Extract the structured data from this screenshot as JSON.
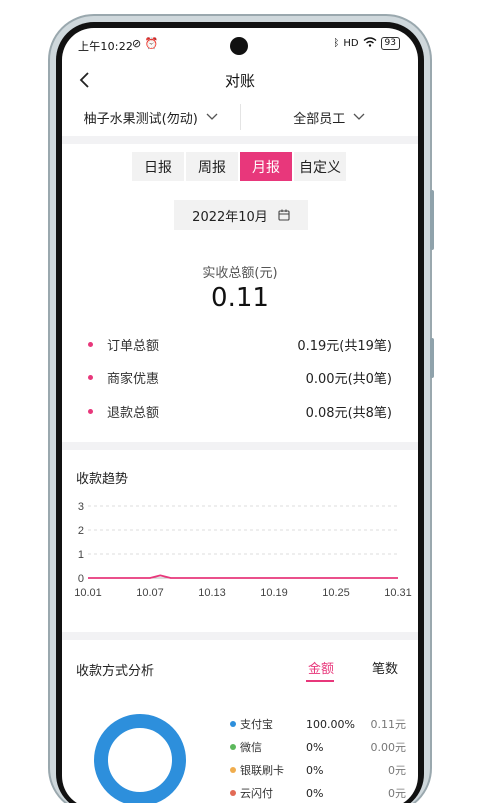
{
  "status_bar": {
    "time": "上午10:22",
    "signal": "HD",
    "battery": "93"
  },
  "nav": {
    "title": "对账"
  },
  "filters": {
    "store": "柚子水果测试(勿动)",
    "staff": "全部员工"
  },
  "period_tabs": [
    {
      "label": "日报",
      "active": false
    },
    {
      "label": "周报",
      "active": false
    },
    {
      "label": "月报",
      "active": true
    },
    {
      "label": "自定义",
      "active": false
    }
  ],
  "date_picker": {
    "value": "2022年10月"
  },
  "summary": {
    "label": "实收总额(元)",
    "value": "0.11"
  },
  "stats": [
    {
      "label": "订单总额",
      "value": "0.19元(共19笔)"
    },
    {
      "label": "商家优惠",
      "value": "0.00元(共0笔)"
    },
    {
      "label": "退款总额",
      "value": "0.08元(共8笔)"
    }
  ],
  "trend": {
    "title": "收款趋势"
  },
  "chart_data": {
    "type": "line",
    "x": [
      "10.01",
      "10.02",
      "10.03",
      "10.04",
      "10.05",
      "10.06",
      "10.07",
      "10.08",
      "10.09",
      "10.10",
      "10.11",
      "10.12",
      "10.13",
      "10.14",
      "10.15",
      "10.16",
      "10.17",
      "10.18",
      "10.19",
      "10.20",
      "10.21",
      "10.22",
      "10.23",
      "10.24",
      "10.25",
      "10.26",
      "10.27",
      "10.28",
      "10.29",
      "10.30",
      "10.31"
    ],
    "x_tick_labels": [
      "10.01",
      "10.07",
      "10.13",
      "10.19",
      "10.25",
      "10.31"
    ],
    "series": [
      {
        "values": [
          0,
          0,
          0,
          0,
          0,
          0,
          0,
          0.11,
          0,
          0,
          0,
          0,
          0,
          0,
          0,
          0,
          0,
          0,
          0,
          0,
          0,
          0,
          0,
          0,
          0,
          0,
          0,
          0,
          0,
          0,
          0
        ],
        "color": "#e8377b"
      }
    ],
    "ylim": [
      0,
      3
    ],
    "y_ticks": [
      0,
      1,
      2,
      3
    ],
    "grid": true
  },
  "payment": {
    "title": "收款方式分析",
    "tab_amount": "金额",
    "tab_count": "笔数",
    "items": [
      {
        "name": "支付宝",
        "pct": "100.00%",
        "amount": "0.11元",
        "color": "#2d8fdc"
      },
      {
        "name": "微信",
        "pct": "0%",
        "amount": "0.00元",
        "color": "#5cb85c"
      },
      {
        "name": "银联刷卡",
        "pct": "0%",
        "amount": "0元",
        "color": "#f0ad4e"
      },
      {
        "name": "云闪付",
        "pct": "0%",
        "amount": "0元",
        "color": "#e26a55"
      }
    ],
    "donut_color": "#2d8fdc"
  }
}
